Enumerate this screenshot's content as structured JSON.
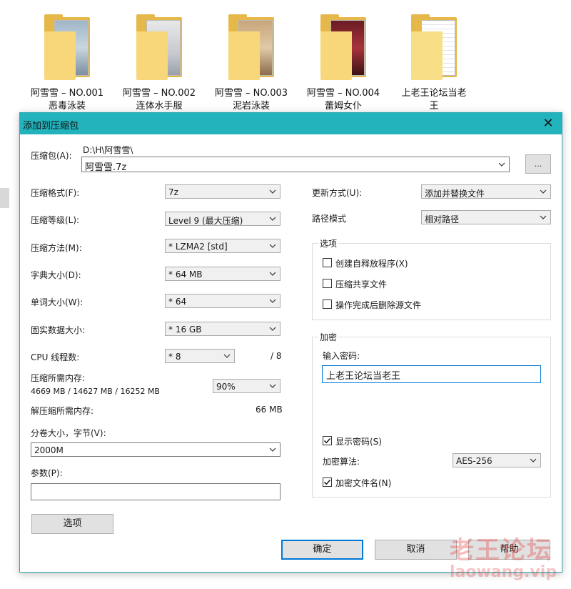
{
  "desktop": {
    "folders": [
      {
        "line1": "阿雪雪 – NO.001",
        "line2": "恶毒泳装"
      },
      {
        "line1": "阿雪雪 – NO.002",
        "line2": "连体水手服"
      },
      {
        "line1": "阿雪雪 – NO.003",
        "line2": "泥岩泳装"
      },
      {
        "line1": "阿雪雪 – NO.004",
        "line2": "蕾姆女仆"
      },
      {
        "line1": "上老王论坛当老",
        "line2": "王"
      }
    ]
  },
  "dialog": {
    "title": "添加到压缩包",
    "close_icon": "close-icon",
    "archive": {
      "label": "压缩包(A):",
      "path": "D:\\H\\阿雪雪\\",
      "filename": "阿雪雪.7z",
      "browse_label": "..."
    },
    "left": {
      "format_label": "压缩格式(F):",
      "format_value": "7z",
      "level_label": "压缩等级(L):",
      "level_value": "Level 9 (最大压缩)",
      "method_label": "压缩方法(M):",
      "method_value": "* LZMA2 [std]",
      "dict_label": "字典大小(D):",
      "dict_value": "* 64 MB",
      "word_label": "单词大小(W):",
      "word_value": "* 64",
      "solid_label": "固实数据大小:",
      "solid_value": "* 16 GB",
      "threads_label": "CPU 线程数:",
      "threads_value": "* 8",
      "threads_max": "/ 8",
      "mem_label": "压缩所需内存:",
      "mem_detail": "4669 MB / 14627 MB / 16252 MB",
      "mem_percent": "90%",
      "decomp_label": "解压缩所需内存:",
      "decomp_value": "66 MB",
      "volume_label": "分卷大小，字节(V):",
      "volume_value": "2000M",
      "params_label": "参数(P):",
      "params_value": "",
      "options_button": "选项"
    },
    "right": {
      "update_label": "更新方式(U):",
      "update_value": "添加并替换文件",
      "path_label": "路径模式",
      "path_value": "相对路径",
      "options_group": "选项",
      "opt_sfx": "创建自释放程序(X)",
      "opt_shared": "压缩共享文件",
      "opt_delete": "操作完成后删除源文件",
      "encrypt_group": "加密",
      "password_label": "输入密码:",
      "password_value": "上老王论坛当老王",
      "show_password": "显示密码(S)",
      "algo_label": "加密算法:",
      "algo_value": "AES-256",
      "encrypt_names": "加密文件名(N)"
    },
    "buttons": {
      "ok": "确定",
      "cancel": "取消",
      "help": "帮助"
    }
  },
  "watermark": {
    "line1": "老王论坛",
    "line2": "laowang.vip"
  },
  "colors": {
    "titlebar": "#23b3bd",
    "folder": "#f7d779",
    "focus": "#0078d7"
  }
}
